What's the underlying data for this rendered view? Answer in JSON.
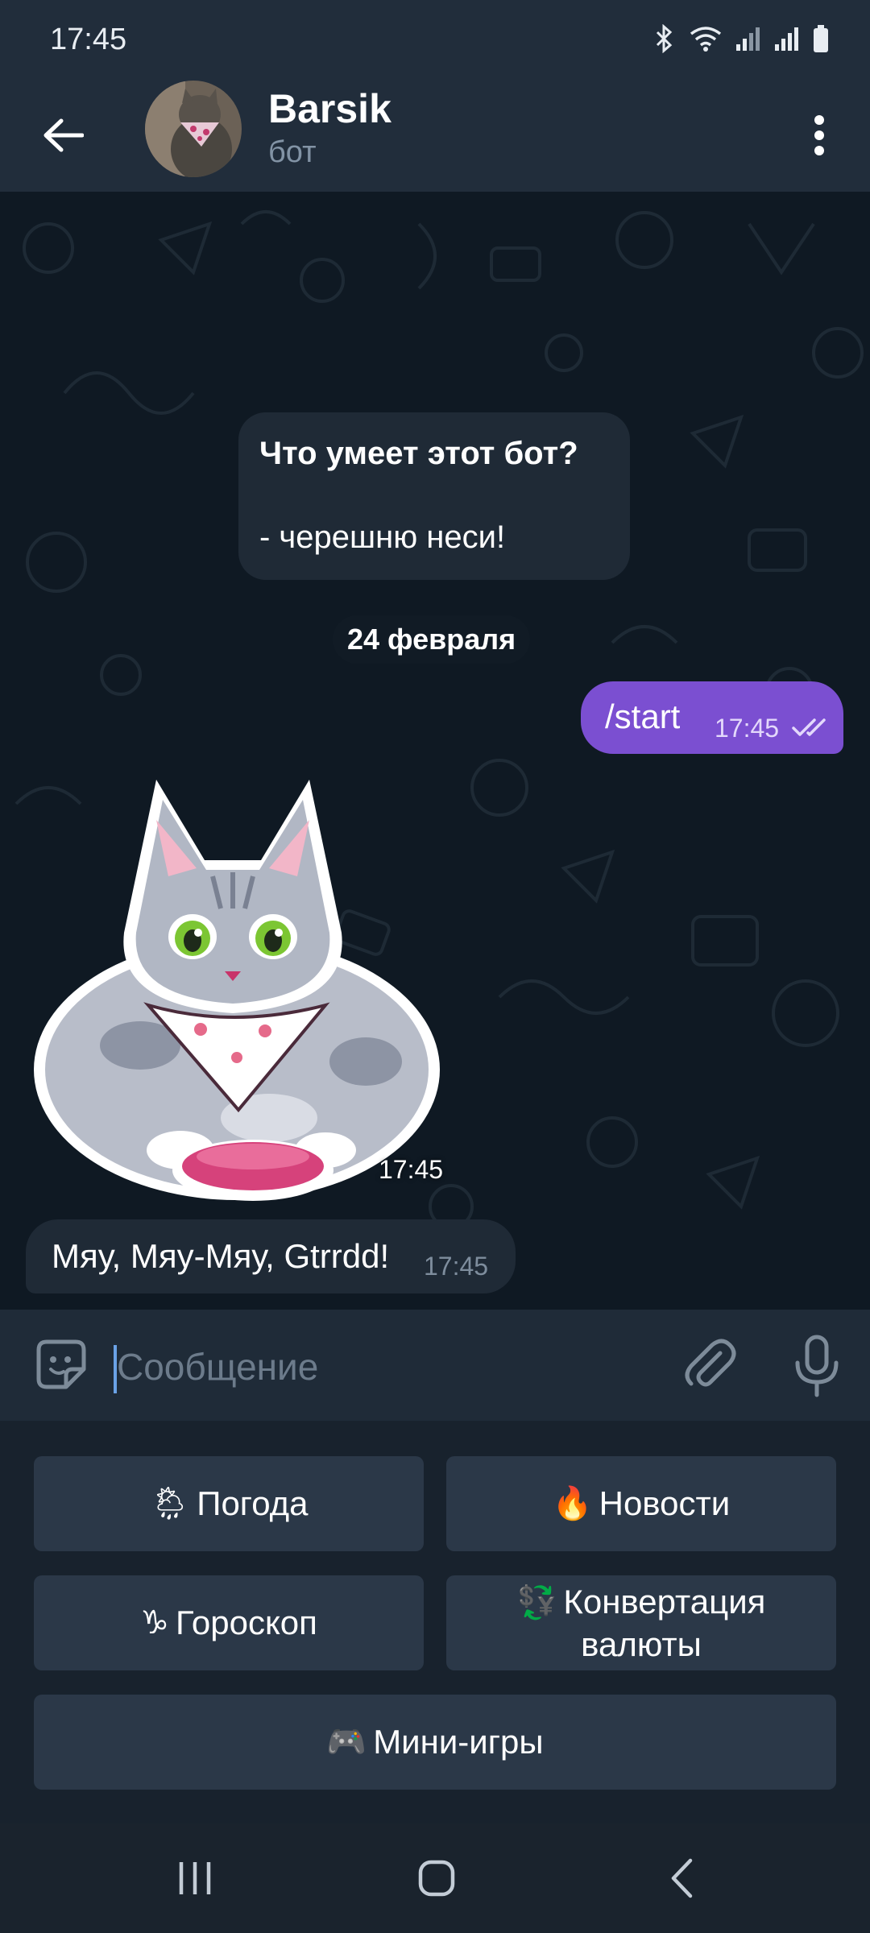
{
  "status_bar": {
    "time": "17:45"
  },
  "header": {
    "title": "Barsik",
    "subtitle": "бот"
  },
  "messages": {
    "bot_info": {
      "title": "Что умеет этот бот?",
      "body": "- черешню неси!"
    },
    "date_separator": "24 февраля",
    "outgoing": {
      "text": "/start",
      "time": "17:45",
      "status": "read"
    },
    "sticker": {
      "time": "17:45"
    },
    "incoming": {
      "text": "Мяу, Мяу-Мяу, Gtrrdd!",
      "time": "17:45"
    }
  },
  "composer": {
    "placeholder": "Сообщение"
  },
  "keyboard": {
    "weather": {
      "emoji": "🌦",
      "label": "Погода"
    },
    "news": {
      "emoji": "🔥",
      "label": "Новости"
    },
    "horoscope": {
      "emoji": "♑",
      "label": "Гороскоп"
    },
    "currency": {
      "emoji": "💱",
      "label": "Конвертация валюты"
    },
    "games": {
      "emoji": "🎮",
      "label": "Мини-игры"
    }
  },
  "colors": {
    "header_bg": "#212d3b",
    "chat_bg": "#0f1923",
    "outgoing_bubble": "#7b4fd1",
    "incoming_bubble": "#1f2a36",
    "keyboard_button": "#2b3848"
  }
}
